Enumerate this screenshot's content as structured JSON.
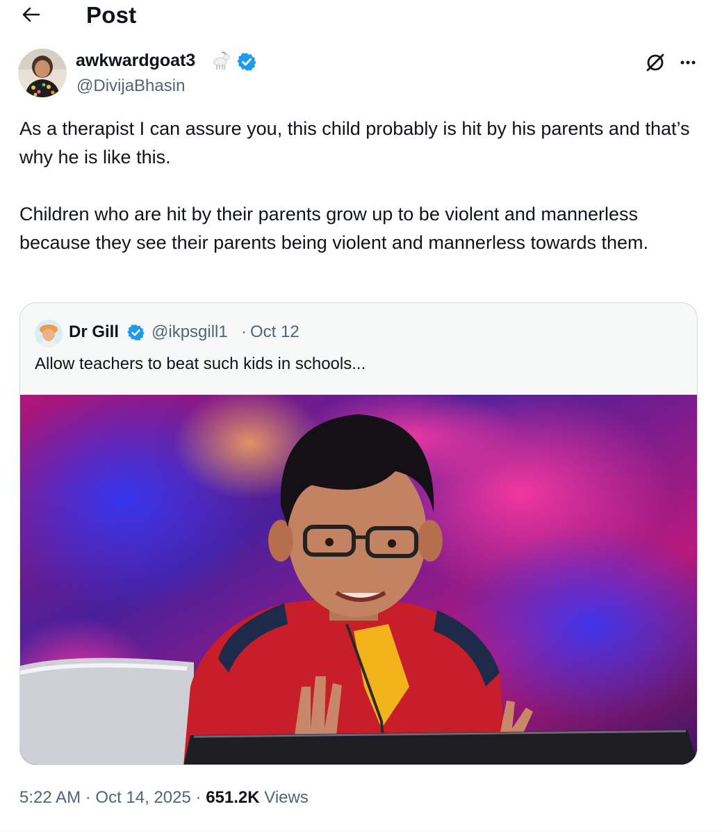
{
  "header": {
    "title": "Post",
    "back_icon": "arrow-left-icon"
  },
  "author": {
    "name": "awkwardgoat3",
    "handle": "@DivijaBhasin",
    "badges": [
      "goat-emoji-icon",
      "verified-badge-icon"
    ],
    "verified_color": "#1d9bf0"
  },
  "post": {
    "paragraphs": [
      "As a therapist I can assure you, this child probably is hit by his parents and that’s why he is like this.",
      "Children who are hit by their parents grow up to be violent and mannerless because they see their parents being violent and mannerless towards them."
    ],
    "time": "5:22 AM",
    "date": "Oct 14, 2025",
    "views_count": "651.2K",
    "views_label": "Views",
    "separator": "·"
  },
  "quote": {
    "name": "Dr Gill",
    "handle": "@ikpsgill1",
    "separator": "·",
    "date": "Oct 12",
    "text": "Allow teachers to beat such kids in schools...",
    "media": "photo-boy-red-jacket-glasses-stage"
  },
  "icons": {
    "grok": "grok-icon",
    "more": "more-horizontal-icon"
  }
}
